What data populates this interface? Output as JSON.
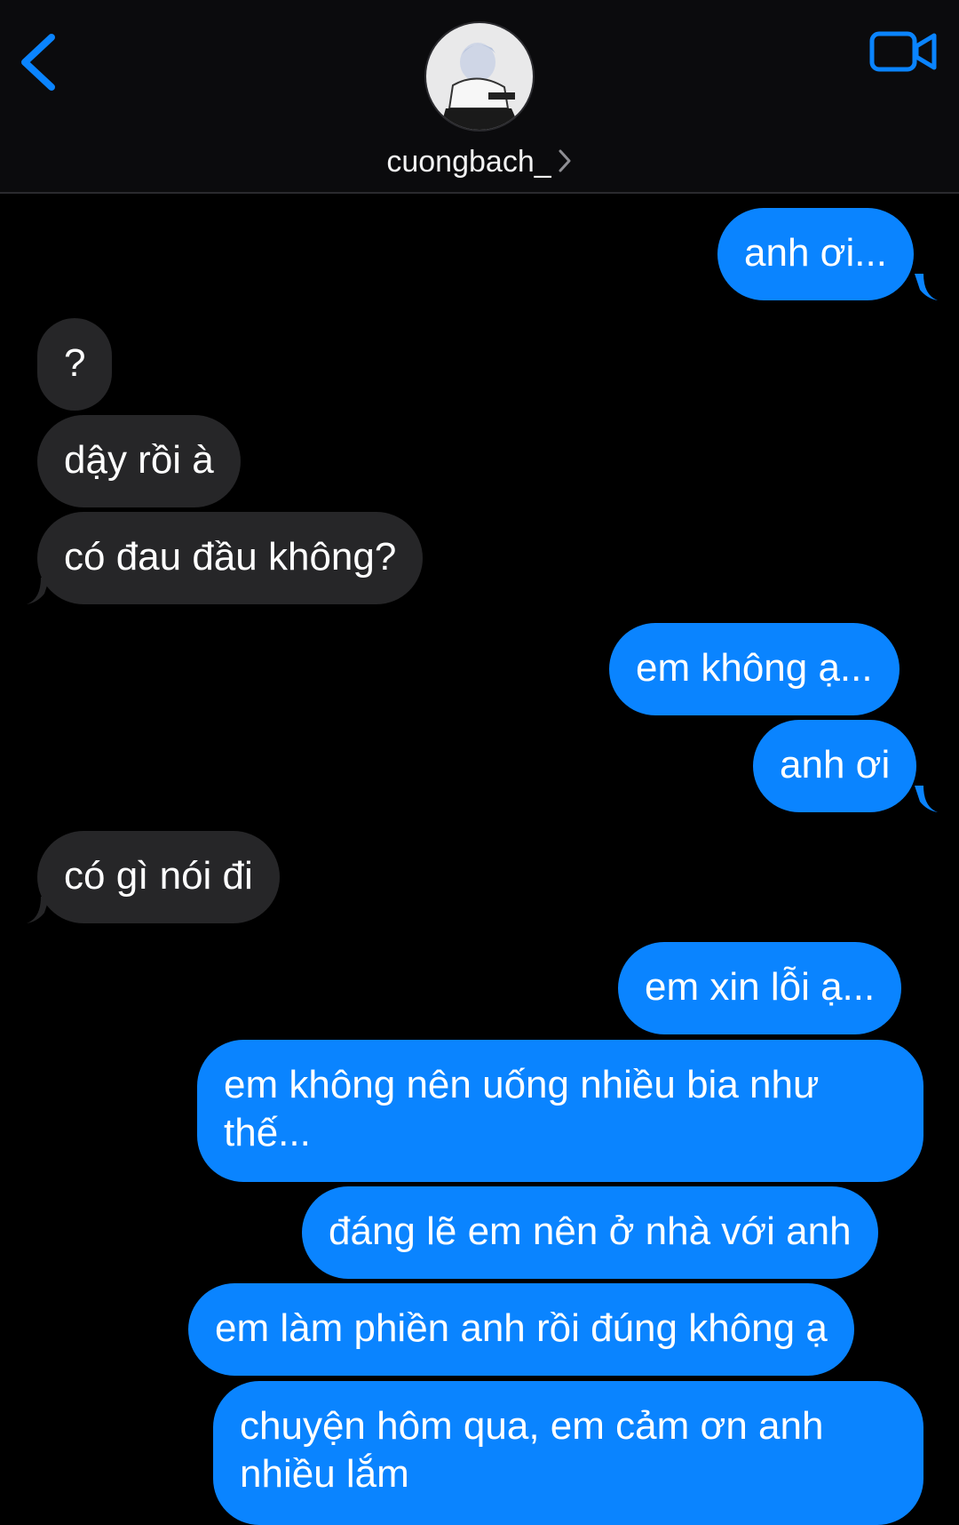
{
  "header": {
    "contact_name": "cuongbach_",
    "icons": {
      "back": "chevron-left-icon",
      "video": "video-camera-icon",
      "disclosure": "chevron-right-icon"
    },
    "colors": {
      "accent": "#0a84ff",
      "outgoing_bubble": "#0a84ff",
      "incoming_bubble": "#262628",
      "background": "#000000"
    }
  },
  "messages": [
    {
      "sender": "me",
      "text": "anh ơi..."
    },
    {
      "sender": "them",
      "text": "?"
    },
    {
      "sender": "them",
      "text": "dậy rồi à"
    },
    {
      "sender": "them",
      "text": "có đau đầu không?"
    },
    {
      "sender": "me",
      "text": "em không ạ..."
    },
    {
      "sender": "me",
      "text": "anh ơi"
    },
    {
      "sender": "them",
      "text": "có gì nói đi"
    },
    {
      "sender": "me",
      "text": "em xin lỗi ạ..."
    },
    {
      "sender": "me",
      "text": "em không nên uống nhiều bia như thế..."
    },
    {
      "sender": "me",
      "text": "đáng lẽ em nên ở nhà với anh"
    },
    {
      "sender": "me",
      "text": "em làm phiền anh rồi đúng không ạ"
    },
    {
      "sender": "me",
      "text": "chuyện hôm qua, em cảm ơn anh nhiều lắm"
    }
  ]
}
